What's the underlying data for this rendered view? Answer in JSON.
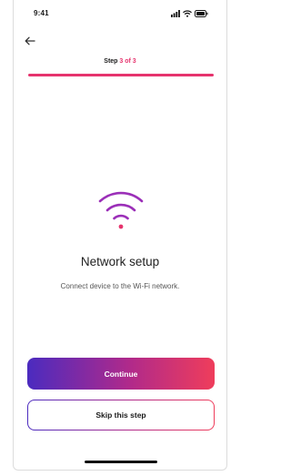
{
  "status_bar": {
    "time": "9:41",
    "icons": [
      "signal-icon",
      "wifi-icon",
      "battery-icon"
    ]
  },
  "nav": {
    "back_icon": "arrow-left-icon"
  },
  "progress": {
    "step_word": "Step",
    "step_current": "3 of 3",
    "fraction": 1.0
  },
  "main": {
    "illustration_icon": "wifi-icon",
    "title": "Network setup",
    "subtitle": "Connect device to the Wi-Fi network."
  },
  "actions": {
    "primary_label": "Continue",
    "secondary_label": "Skip this step"
  },
  "colors": {
    "accent_pink": "#e6336d",
    "gradient_start": "#4b2bbf",
    "gradient_mid": "#b12a8a",
    "gradient_end": "#ef3d5b",
    "wifi_purple": "#9b2fb8"
  }
}
